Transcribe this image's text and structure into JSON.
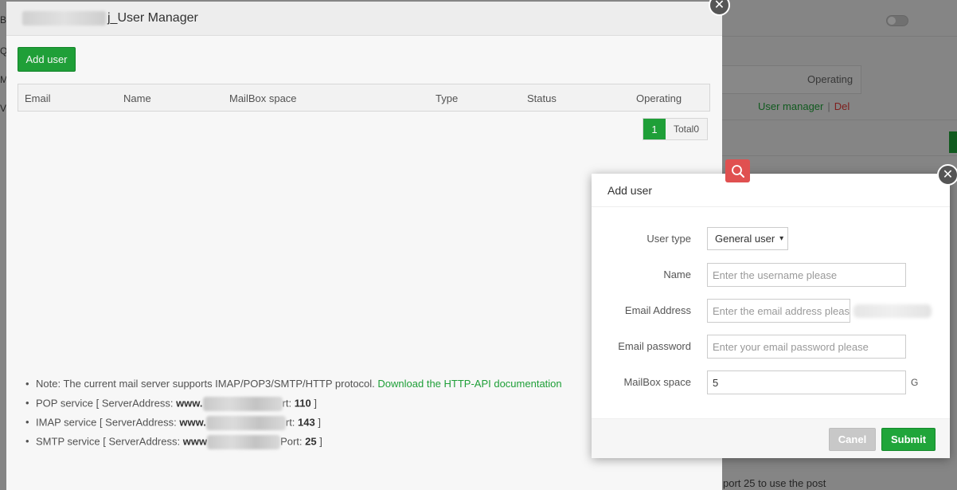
{
  "background": {
    "operating_label": "Operating",
    "user_manager_link": "User manager",
    "separator": "|",
    "delete_link": "Del",
    "bottom_text": "port 25 to use the post",
    "left_letters": [
      "B",
      "Q",
      "M",
      "V"
    ]
  },
  "user_manager": {
    "title_suffix": "j_User Manager",
    "close_glyph": "✕",
    "add_user_label": "Add user",
    "columns": [
      "Email",
      "Name",
      "MailBox space",
      "Type",
      "Status",
      "Operating"
    ],
    "pagination": {
      "current_page": "1",
      "total_text": "Total0"
    },
    "notes": {
      "note_text": "Note: The current mail server supports IMAP/POP3/SMTP/HTTP protocol.",
      "note_link": "Download the HTTP-API documentation",
      "pop_prefix": "POP service [ ServerAddress:",
      "pop_host": "www.",
      "pop_port_label": "rt:",
      "pop_port": "110",
      "imap_prefix": "IMAP service [ ServerAddress:",
      "imap_host": "www.",
      "imap_port_label": "rt:",
      "imap_port": "143",
      "smtp_prefix": "SMTP service [ ServerAddress:",
      "smtp_host": "www",
      "smtp_port_label": "Port:",
      "smtp_port": "25",
      "close_bracket": "]"
    }
  },
  "add_user_dialog": {
    "title": "Add user",
    "close_glyph": "✕",
    "user_type": {
      "label": "User type",
      "selected": "General user",
      "caret": "▾"
    },
    "name": {
      "label": "Name",
      "value": "",
      "placeholder": "Enter the username please"
    },
    "email": {
      "label": "Email Address",
      "value": "",
      "placeholder": "Enter the email address please"
    },
    "password": {
      "label": "Email password",
      "value": "",
      "placeholder": "Enter your email password please"
    },
    "mailbox_space": {
      "label": "MailBox space",
      "value": "5",
      "unit": "G"
    },
    "cancel_label": "Canel",
    "submit_label": "Submit"
  },
  "colors": {
    "accent_green": "#20a53a",
    "danger_red": "#e53935",
    "search_badge": "#e05050"
  }
}
